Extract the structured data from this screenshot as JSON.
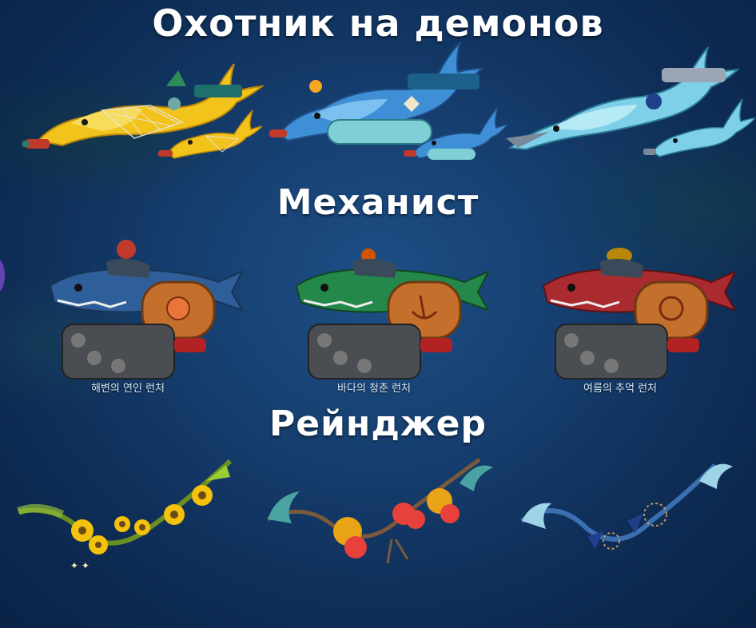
{
  "sections": {
    "demon_hunter": {
      "title": "Охотник на демонов"
    },
    "machinist": {
      "title": "Механист",
      "items": [
        {
          "caption": "해변의 연인 런처",
          "body_color": "#2f5f9a",
          "accent": "#c0392b"
        },
        {
          "caption": "바다의 청춘 런처",
          "body_color": "#23884a",
          "accent": "#d35400"
        },
        {
          "caption": "여름의 추억 런처",
          "body_color": "#a92a2f",
          "accent": "#b8860b"
        }
      ]
    },
    "ranger": {
      "title": "Рейнджер"
    }
  },
  "colors": {
    "background": "#163f70",
    "title_text": "#ffffff",
    "caption_text": "#d9ecff"
  }
}
